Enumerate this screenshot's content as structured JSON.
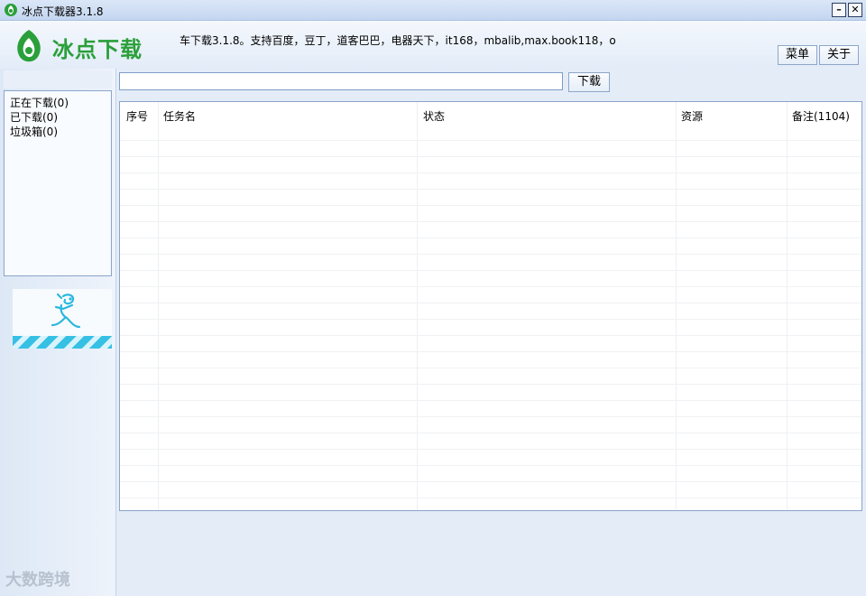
{
  "window": {
    "title": "冰点下载器3.1.8",
    "minimize_label": "–",
    "close_label": "✕"
  },
  "header": {
    "logo_text": "冰点下载",
    "notice": "车下载3.1.8。支持百度，豆丁，道客巴巴，电器天下，it168，mbalib,max.book118，o",
    "menu_label": "菜单",
    "about_label": "关于"
  },
  "search": {
    "value": "",
    "download_label": "下载"
  },
  "sidebar": {
    "items": [
      {
        "label": "正在下载(0)"
      },
      {
        "label": "已下载(0)"
      },
      {
        "label": "垃圾箱(0)"
      }
    ]
  },
  "table": {
    "columns": [
      "序号",
      "任务名",
      "状态",
      "资源",
      "备注(1104)"
    ],
    "rows": []
  },
  "watermark": {
    "text": "大数跨境"
  },
  "colors": {
    "brand_green": "#2a9f3a",
    "window_bg": "#e4ecf8",
    "border_blue": "#8aa4c8"
  }
}
